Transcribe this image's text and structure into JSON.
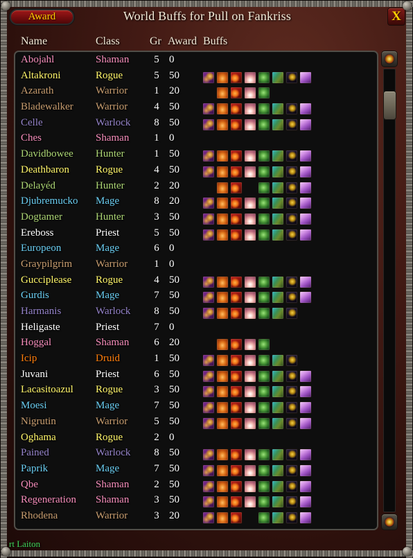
{
  "window": {
    "title": "World Buffs for Pull on Fankriss",
    "award_button_label": "Award",
    "close_label": "X"
  },
  "colors": {
    "Shaman": "#f58cba",
    "Rogue": "#fff569",
    "Warrior": "#c79c6e",
    "Warlock": "#9482c9",
    "Hunter": "#abd473",
    "Mage": "#69ccf0",
    "Priest": "#ffffff",
    "Druid": "#ff7d0a",
    "Paladin": "#f58cba",
    "accent_gold": "#ffd100",
    "panel_background": "#0e0e0e",
    "frame_red": "#421a14"
  },
  "columns": {
    "name": "Name",
    "class": "Class",
    "gr": "Gr",
    "award": "Award",
    "buffs": "Buffs"
  },
  "buff_types": [
    {
      "key": "songflower",
      "name": "songflower-serenade-icon",
      "css": "bf-songflower"
    },
    {
      "key": "rend",
      "name": "warchiefs-blessing-icon",
      "css": "bf-rend"
    },
    {
      "key": "dragonslayer",
      "name": "rallying-cry-dragonslayer-icon",
      "css": "bf-dragonslayer"
    },
    {
      "key": "zandalar",
      "name": "spirit-of-zandalar-icon",
      "css": "bf-zandalar"
    },
    {
      "key": "onyxia",
      "name": "dragonslayer-onyxia-icon",
      "css": "bf-onyxia"
    },
    {
      "key": "spirit",
      "name": "traces-of-silithyst-icon",
      "css": "bf-spirit"
    },
    {
      "key": "dmf",
      "name": "darkmoon-faire-buff-icon",
      "css": "bf-dmf"
    },
    {
      "key": "shard",
      "name": "sayges-dark-fortune-icon",
      "css": "bf-shard"
    }
  ],
  "scrollbar": {
    "up_label": "scroll up",
    "down_label": "scroll down"
  },
  "chat": {
    "text": "rt Laiton"
  },
  "rows": [
    {
      "name": "Abojahl",
      "class": "Shaman",
      "gr": "5",
      "award": "0",
      "buffs": []
    },
    {
      "name": "Altakroni",
      "class": "Rogue",
      "gr": "5",
      "award": "50",
      "buffs": [
        1,
        1,
        1,
        1,
        1,
        1,
        1,
        1
      ]
    },
    {
      "name": "Azarath",
      "class": "Warrior",
      "gr": "1",
      "award": "20",
      "buffs": [
        0,
        1,
        1,
        1,
        1,
        0,
        0,
        0
      ]
    },
    {
      "name": "Bladewalker",
      "class": "Warrior",
      "gr": "4",
      "award": "50",
      "buffs": [
        1,
        1,
        1,
        1,
        1,
        1,
        1,
        1
      ]
    },
    {
      "name": "Celle",
      "class": "Warlock",
      "gr": "8",
      "award": "50",
      "buffs": [
        1,
        1,
        1,
        1,
        1,
        1,
        1,
        1
      ]
    },
    {
      "name": "Ches",
      "class": "Shaman",
      "gr": "1",
      "award": "0",
      "buffs": []
    },
    {
      "name": "Davidbowee",
      "class": "Hunter",
      "gr": "1",
      "award": "50",
      "buffs": [
        1,
        1,
        1,
        1,
        1,
        1,
        1,
        1
      ]
    },
    {
      "name": "Deathbaron",
      "class": "Rogue",
      "gr": "4",
      "award": "50",
      "buffs": [
        1,
        1,
        1,
        1,
        1,
        1,
        1,
        1
      ]
    },
    {
      "name": "Delayéd",
      "class": "Hunter",
      "gr": "2",
      "award": "20",
      "buffs": [
        0,
        1,
        1,
        0,
        1,
        1,
        1,
        1
      ]
    },
    {
      "name": "Djubremucko",
      "class": "Mage",
      "gr": "8",
      "award": "20",
      "buffs": [
        1,
        1,
        1,
        1,
        1,
        1,
        1,
        1
      ]
    },
    {
      "name": "Dogtamer",
      "class": "Hunter",
      "gr": "3",
      "award": "50",
      "buffs": [
        1,
        1,
        1,
        1,
        1,
        1,
        1,
        1
      ]
    },
    {
      "name": "Ereboss",
      "class": "Priest",
      "gr": "5",
      "award": "50",
      "buffs": [
        1,
        1,
        1,
        1,
        1,
        1,
        1,
        1
      ]
    },
    {
      "name": "Europeon",
      "class": "Mage",
      "gr": "6",
      "award": "0",
      "buffs": []
    },
    {
      "name": "Graypilgrim",
      "class": "Warrior",
      "gr": "1",
      "award": "0",
      "buffs": []
    },
    {
      "name": "Gucciplease",
      "class": "Rogue",
      "gr": "4",
      "award": "50",
      "buffs": [
        1,
        1,
        1,
        1,
        1,
        1,
        1,
        1
      ]
    },
    {
      "name": "Gurdis",
      "class": "Mage",
      "gr": "7",
      "award": "50",
      "buffs": [
        1,
        1,
        1,
        1,
        1,
        1,
        1,
        1
      ]
    },
    {
      "name": "Harmanis",
      "class": "Warlock",
      "gr": "8",
      "award": "50",
      "buffs": [
        1,
        1,
        1,
        1,
        1,
        1,
        1,
        0
      ]
    },
    {
      "name": "Heligaste",
      "class": "Priest",
      "gr": "7",
      "award": "0",
      "buffs": []
    },
    {
      "name": "Hoggal",
      "class": "Shaman",
      "gr": "6",
      "award": "20",
      "buffs": [
        0,
        1,
        1,
        1,
        1,
        0,
        0,
        0
      ]
    },
    {
      "name": "Icip",
      "class": "Druid",
      "gr": "1",
      "award": "50",
      "buffs": [
        1,
        1,
        1,
        1,
        1,
        1,
        1,
        0
      ]
    },
    {
      "name": "Juvani",
      "class": "Priest",
      "gr": "6",
      "award": "50",
      "buffs": [
        1,
        1,
        1,
        1,
        1,
        1,
        1,
        1
      ]
    },
    {
      "name": "Lacasitoazul",
      "class": "Rogue",
      "gr": "3",
      "award": "50",
      "buffs": [
        1,
        1,
        1,
        1,
        1,
        1,
        1,
        1
      ]
    },
    {
      "name": "Moesi",
      "class": "Mage",
      "gr": "7",
      "award": "50",
      "buffs": [
        1,
        1,
        1,
        1,
        1,
        1,
        1,
        1
      ]
    },
    {
      "name": "Nigrutin",
      "class": "Warrior",
      "gr": "5",
      "award": "50",
      "buffs": [
        1,
        1,
        1,
        1,
        1,
        1,
        1,
        1
      ]
    },
    {
      "name": "Oghama",
      "class": "Rogue",
      "gr": "2",
      "award": "0",
      "buffs": []
    },
    {
      "name": "Pained",
      "class": "Warlock",
      "gr": "8",
      "award": "50",
      "buffs": [
        1,
        1,
        1,
        1,
        1,
        1,
        1,
        1
      ]
    },
    {
      "name": "Paprik",
      "class": "Mage",
      "gr": "7",
      "award": "50",
      "buffs": [
        1,
        1,
        1,
        1,
        1,
        1,
        1,
        1
      ]
    },
    {
      "name": "Qbe",
      "class": "Shaman",
      "gr": "2",
      "award": "50",
      "buffs": [
        1,
        1,
        1,
        1,
        1,
        1,
        1,
        1
      ]
    },
    {
      "name": "Regeneration",
      "class": "Shaman",
      "gr": "3",
      "award": "50",
      "buffs": [
        1,
        1,
        1,
        1,
        1,
        1,
        1,
        1
      ]
    },
    {
      "name": "Rhodena",
      "class": "Warrior",
      "gr": "3",
      "award": "20",
      "buffs": [
        1,
        1,
        1,
        0,
        1,
        1,
        1,
        1
      ]
    }
  ]
}
